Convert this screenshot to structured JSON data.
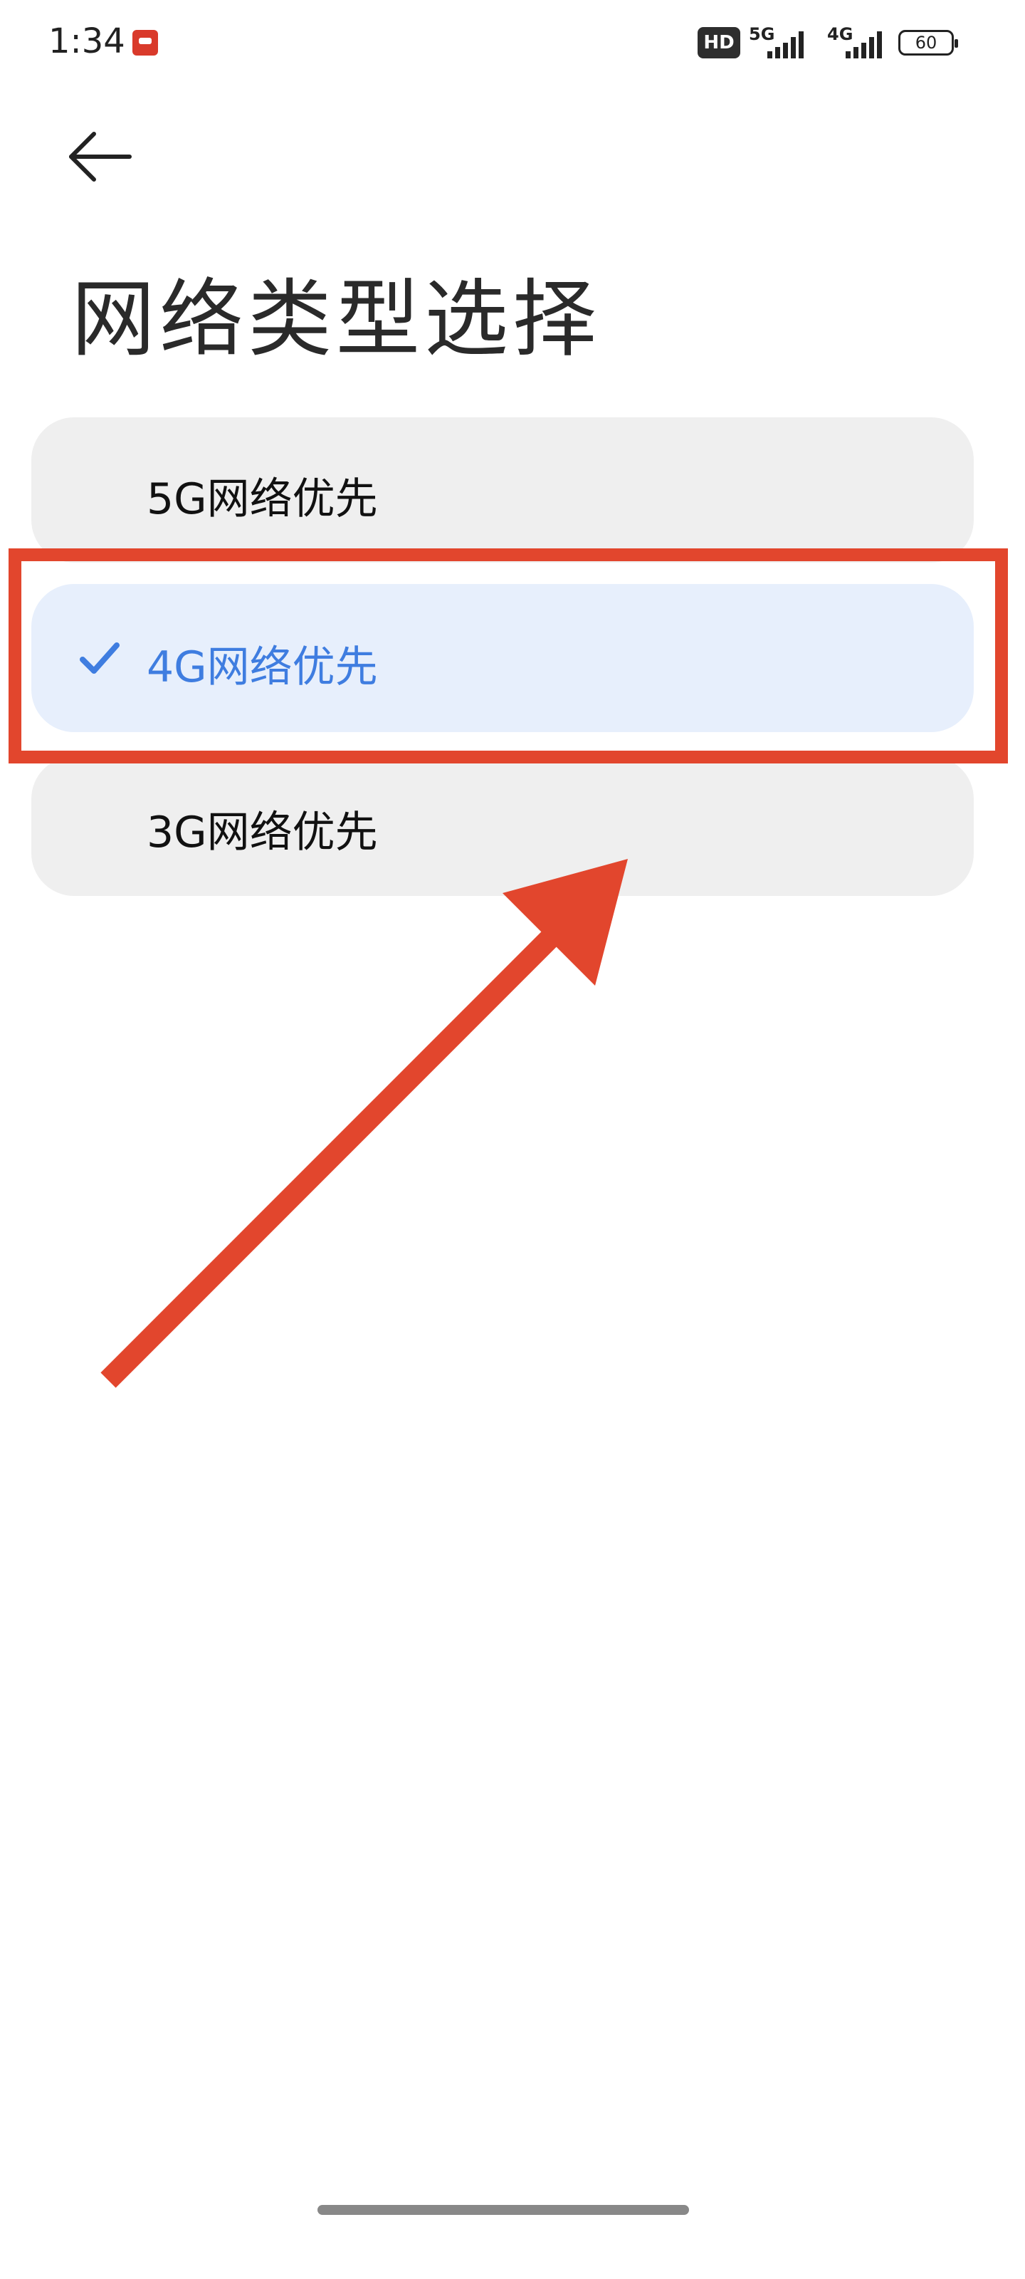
{
  "status_bar": {
    "time": "1:34",
    "hd_label": "HD",
    "network_1": "5G",
    "network_2": "4G",
    "battery": "60"
  },
  "header": {
    "back_icon": "arrow-left-icon",
    "title": "网络类型选择"
  },
  "options": [
    {
      "label": "5G网络优先",
      "selected": false
    },
    {
      "label": "4G网络优先",
      "selected": true
    },
    {
      "label": "3G网络优先",
      "selected": false
    }
  ],
  "colors": {
    "accent": "#3f7de0",
    "selected_bg": "#e7effc",
    "option_bg": "#efefef",
    "annotation": "#e2462d"
  },
  "icons": {
    "check": "check-icon",
    "notification": "app-notification-icon",
    "annotation_arrow": "annotation-arrow"
  }
}
